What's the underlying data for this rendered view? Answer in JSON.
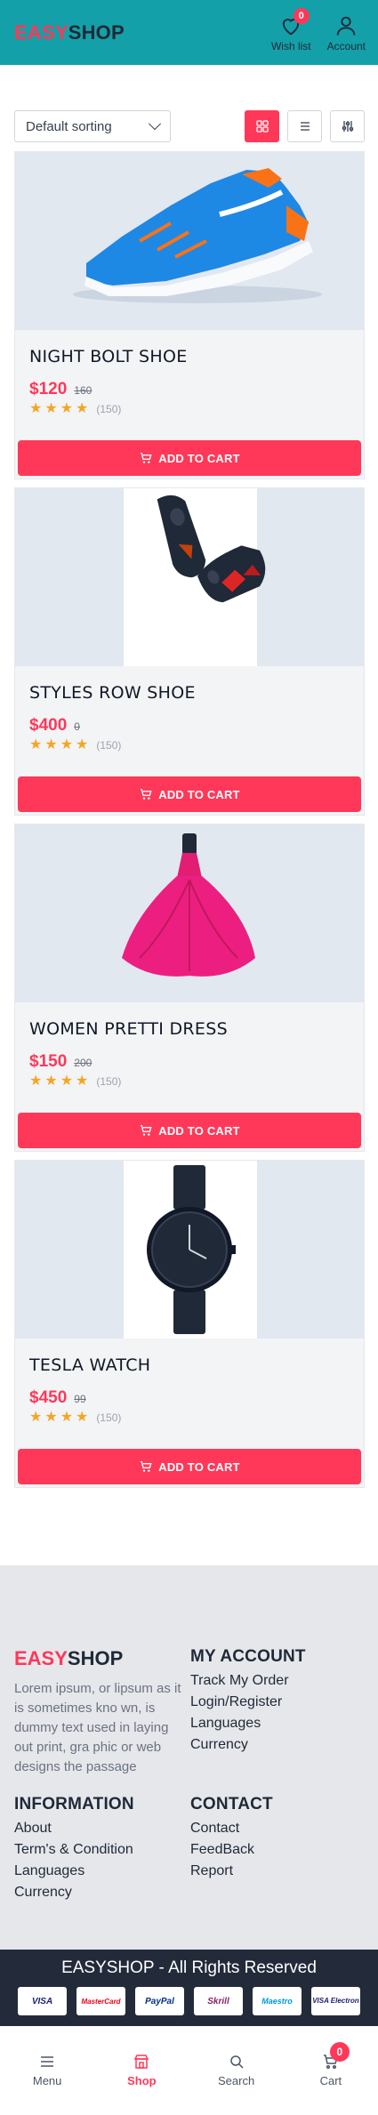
{
  "header": {
    "logo_easy": "EASY",
    "logo_shop": "SHOP",
    "wishlist_label": "Wish list",
    "wishlist_count": "0",
    "account_label": "Account",
    "bg_color": "#14a0a8",
    "accent": "#ff3859"
  },
  "toolbar": {
    "sort_selected": "Default sorting",
    "views": [
      "grid-icon",
      "list-icon",
      "filter-icon"
    ]
  },
  "products": [
    {
      "name": "NIGHT BOLT SHOE",
      "price": "$120",
      "old_price": "160",
      "rating_count": "(150)",
      "button": "ADD TO CART",
      "image": "blue-sneaker"
    },
    {
      "name": "STYLES ROW SHOE",
      "price": "$400",
      "old_price": "0",
      "rating_count": "(150)",
      "button": "ADD TO CART",
      "image": "black-sneakers"
    },
    {
      "name": "WOMEN PRETTI DRESS",
      "price": "$150",
      "old_price": "200",
      "rating_count": "(150)",
      "button": "ADD TO CART",
      "image": "pink-dress"
    },
    {
      "name": "TESLA WATCH",
      "price": "$450",
      "old_price": "99",
      "rating_count": "(150)",
      "button": "ADD TO CART",
      "image": "black-watch"
    }
  ],
  "rating_stars": 4,
  "footer": {
    "logo_easy": "EASY",
    "logo_shop": "SHOP",
    "description": "Lorem ipsum, or lipsum as it is sometimes kno wn, is dummy text used in laying out print, gra phic or web designs the passage",
    "account_title": "MY ACCOUNT",
    "account_links": [
      "Track My Order",
      "Login/Register",
      "Languages",
      "Currency"
    ],
    "info_title": "INFORMATION",
    "info_links": [
      "About",
      "Term's & Condition",
      "Languages",
      "Currency"
    ],
    "contact_title": "CONTACT",
    "contact_links": [
      "Contact",
      "FeedBack",
      "Report"
    ],
    "copyright": "EASYSHOP - All Rights Reserved",
    "payments": [
      "VISA",
      "MasterCard",
      "PayPal",
      "Skrill",
      "Maestro",
      "VISA Electron"
    ]
  },
  "bottom_nav": {
    "menu": "Menu",
    "shop": "Shop",
    "search": "Search",
    "cart": "Cart",
    "cart_count": "0"
  }
}
